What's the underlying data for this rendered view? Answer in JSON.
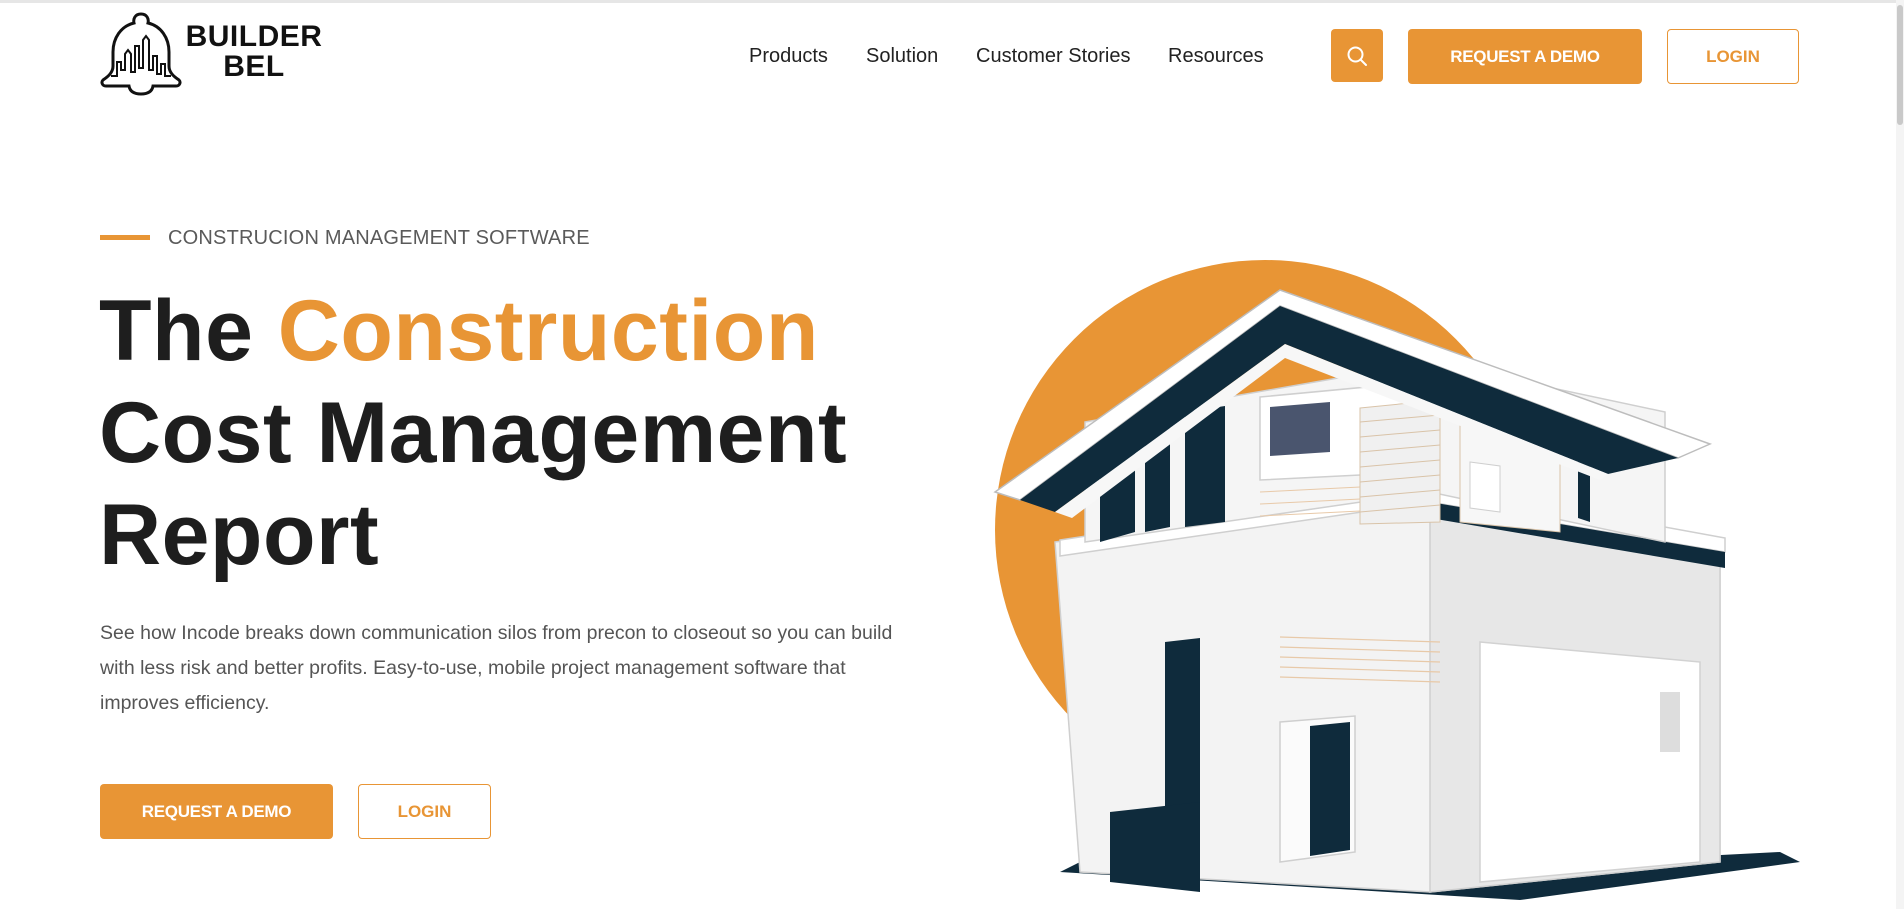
{
  "brand": {
    "line1": "BUILDER",
    "line2": "BEL",
    "accent_color": "#E89535",
    "dark_color": "#0F2B3C"
  },
  "nav": {
    "items": [
      "Products",
      "Solution",
      "Customer Stories",
      "Resources"
    ]
  },
  "header": {
    "search_icon": "search-icon",
    "request_demo": "REQUEST A DEMO",
    "login": "LOGIN"
  },
  "hero": {
    "eyebrow": "CONSTRUCION MANAGEMENT SOFTWARE",
    "title_line1_plain": "The ",
    "title_line1_accent": "Construction",
    "title_line2": "Cost Management",
    "title_line3": "Report",
    "description": "See how Incode breaks down communication silos from precon to closeout so you can build with less risk and better profits. Easy-to-use, mobile project management software that improves efficiency.",
    "request_demo": "REQUEST A DEMO",
    "login": "LOGIN"
  }
}
